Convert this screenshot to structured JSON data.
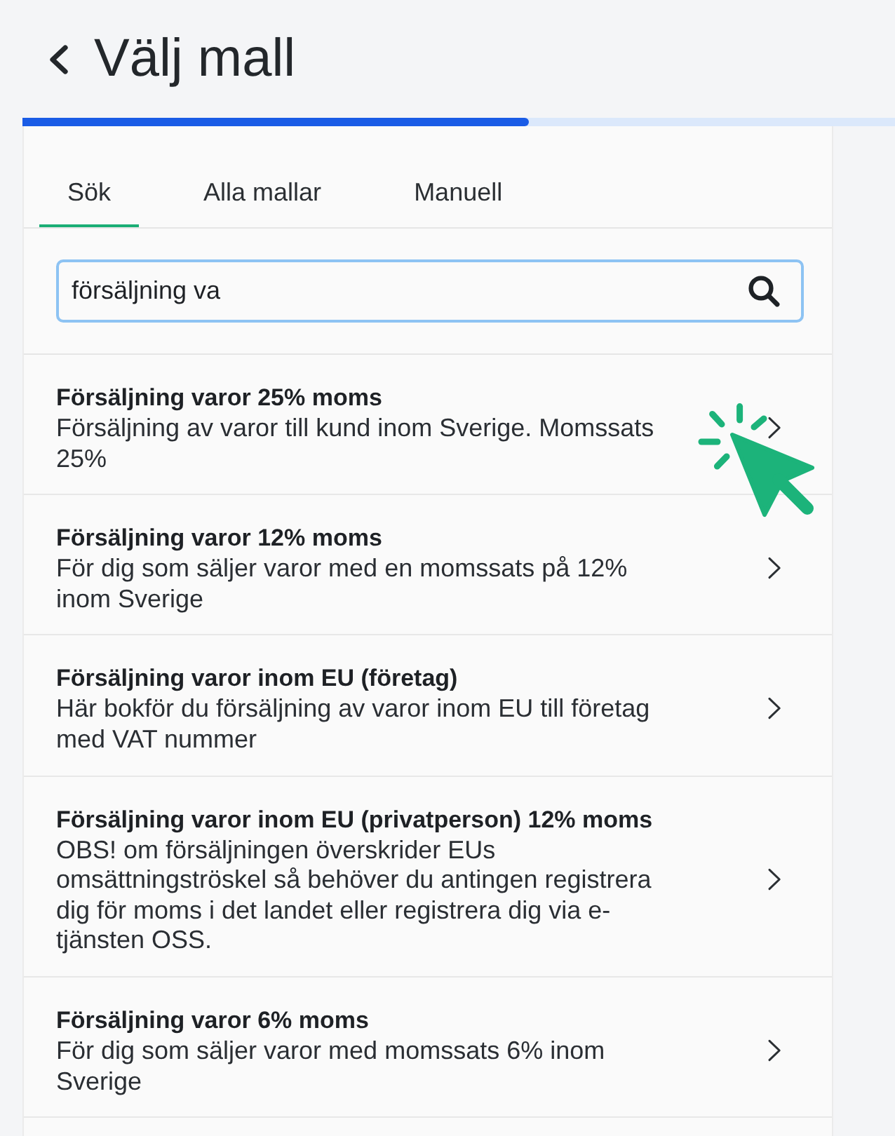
{
  "header": {
    "title": "Välj mall"
  },
  "progress": {
    "level": 0.58
  },
  "tabs": [
    {
      "label": "Sök",
      "selected": true
    },
    {
      "label": "Alla mallar",
      "selected": false
    },
    {
      "label": "Manuell",
      "selected": false
    }
  ],
  "search": {
    "value": "försäljning va"
  },
  "templates": [
    {
      "title": "Försäljning varor 25% moms",
      "description": "Försäljning av varor till kund inom Sverige. Momssats 25%"
    },
    {
      "title": "Försäljning varor 12% moms",
      "description": "För dig som säljer varor med en momssats på 12% inom Sverige"
    },
    {
      "title": "Försäljning varor inom EU (företag)",
      "description": "Här bokför du försäljning av varor inom EU till företag med VAT nummer"
    },
    {
      "title": "Försäljning varor inom EU (privatperson) 12% moms",
      "description": "OBS! om försäljningen överskrider EUs omsättningströskel så behöver du antingen registrera dig för moms i det landet eller registrera dig via e-tjänsten OSS."
    },
    {
      "title": "Försäljning varor 6% moms",
      "description": "För dig som säljer varor med momssats 6% inom Sverige"
    }
  ]
}
